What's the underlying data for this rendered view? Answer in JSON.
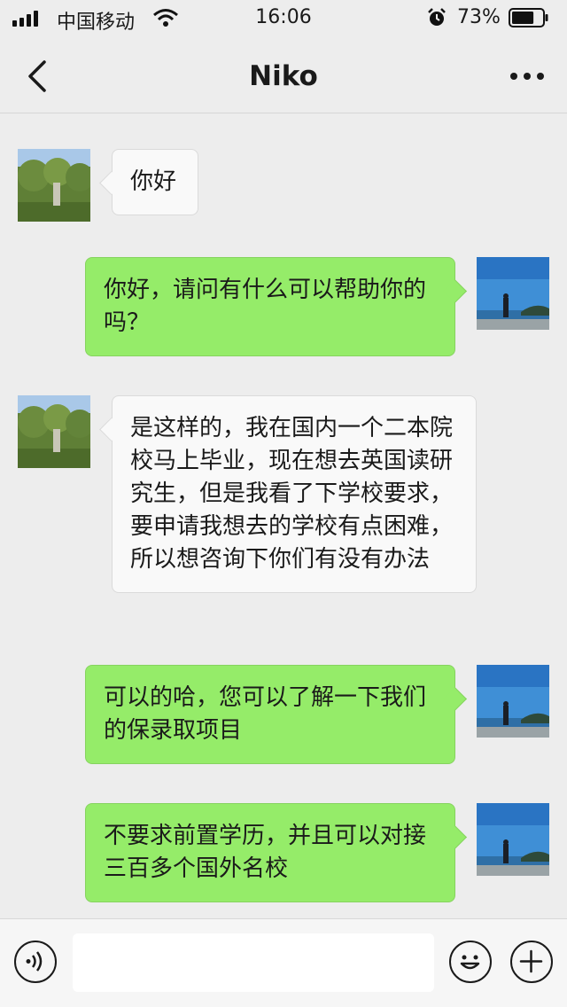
{
  "status_bar": {
    "carrier": "中国移动",
    "time": "16:06",
    "battery_percent": "73%",
    "battery_level": 0.73,
    "icons": [
      "signal-icon",
      "wifi-icon",
      "alarm-icon",
      "battery-icon"
    ]
  },
  "nav": {
    "title": "Niko",
    "back_icon": "chevron-left-icon",
    "more_icon": "more-dots-icon"
  },
  "messages": [
    {
      "sender": "them",
      "text": "你好"
    },
    {
      "sender": "me",
      "text": "你好，请问有什么可以帮助你的吗？"
    },
    {
      "sender": "them",
      "text": "是这样的，我在国内一个二本院校马上毕业，现在想去英国读研究生，但是我看了下学校要求，要申请我想去的学校有点困难，所以想咨询下你们有没有办法"
    },
    {
      "sender": "me",
      "text": "可以的哈，您可以了解一下我们的保录取项目"
    },
    {
      "sender": "me",
      "text": "不要求前置学历，并且可以对接三百多个国外名校"
    }
  ],
  "input_bar": {
    "input_value": "",
    "icons": [
      "voice-icon",
      "emoji-icon",
      "plus-icon"
    ]
  },
  "colors": {
    "background": "#ededed",
    "incoming_bubble": "#f9f9f9",
    "outgoing_bubble": "#95ec69"
  }
}
